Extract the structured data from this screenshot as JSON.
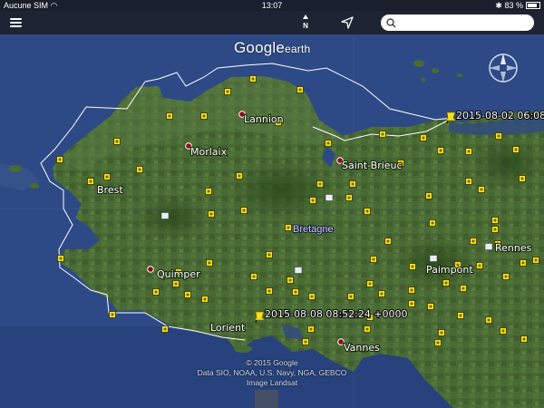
{
  "status_bar": {
    "carrier": "Aucune SIM",
    "time": "13:07",
    "battery": "83 %"
  },
  "toolbar": {
    "north_label": "N",
    "search_placeholder": ""
  },
  "logo": {
    "brand": "Google",
    "product": "earth"
  },
  "copyright": {
    "line1": "© 2015 Google",
    "line2": "Data SIO, NOAA, U.S. Navy, NGA, GEBCO",
    "line3": "Image Landsat"
  },
  "region_label": "Bretagne",
  "cities": [
    "Lannion",
    "Morlaix",
    "Saint-Brieuc",
    "Brest",
    "Quimper",
    "Lorient",
    "Vannes",
    "Rennes",
    "Paimpont"
  ],
  "placemarks": [
    "2015-08-02 06:08:3",
    "2015-08-08 08:52:24 +0000"
  ],
  "colors": {
    "sea": "#2e4a86",
    "land": "#3e5c2b",
    "toolbar": "#1e2433",
    "placemark": "#f2e11b",
    "city_dot": "#8b0d1a"
  }
}
